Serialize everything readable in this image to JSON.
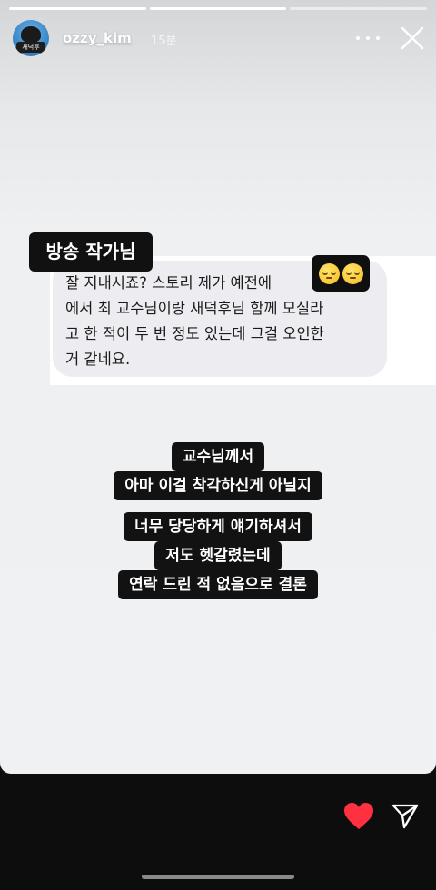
{
  "header": {
    "username": "ozzy_kim",
    "time": "15분",
    "avatar_tag": "새덕후"
  },
  "progress": {
    "segments": 3,
    "current": 1
  },
  "post": {
    "label": "방송 작가님",
    "message": "잘 지내시죠? 스토리 제가 예전에\n에서 최 교수님이랑 새덕후님 함께 모실라\n고 한 적이 두 번 정도 있는데 그걸 오인한\n거 같네요.",
    "emoji": "relieved-face-icon x2"
  },
  "captions": {
    "group1": [
      "교수님께서",
      "아마 이걸 착각하신게 아닐지"
    ],
    "group2": [
      "너무 당당하게 얘기하셔서",
      "저도 헷갈렸는데",
      "연락 드린 적 없음으로 결론"
    ]
  },
  "colors": {
    "heart": "#ff3040",
    "caption_bg": "#121212",
    "bubble_bg": "#ededf1"
  },
  "icons": [
    "more-icon",
    "close-icon",
    "heart-icon",
    "send-icon"
  ]
}
